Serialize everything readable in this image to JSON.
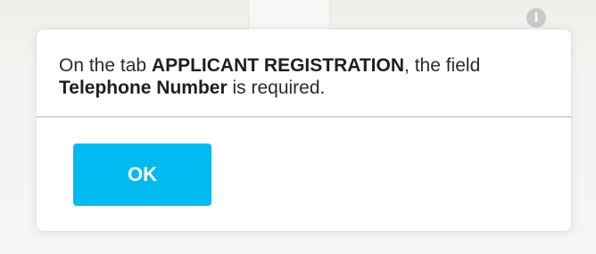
{
  "background": {
    "info_icon": "info-icon"
  },
  "dialog": {
    "message": {
      "part1": "On the tab ",
      "tab_name": "APPLICANT REGISTRATION",
      "part2": ", the field ",
      "field_name": "Telephone Number",
      "part3": " is required."
    },
    "ok_label": "OK"
  },
  "colors": {
    "accent": "#00baf2",
    "dialog_background": "#ffffff",
    "text": "#2b2b2b"
  }
}
